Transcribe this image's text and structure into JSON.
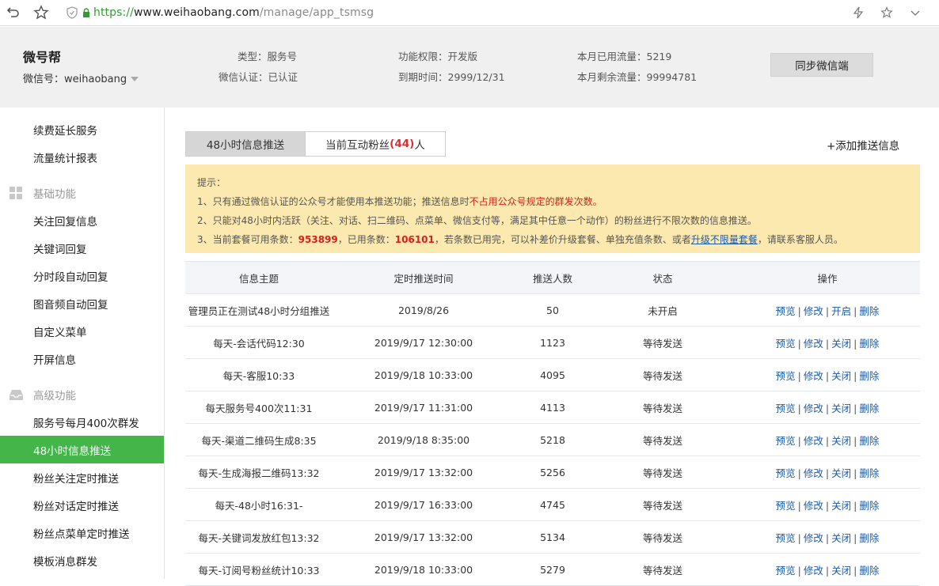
{
  "browser": {
    "url_scheme": "https://",
    "url_host": "www.weihaobang.com",
    "url_path": "/manage/app_tsmsg"
  },
  "account": {
    "name": "微号帮",
    "wechat_id_label": "微信号：weihaobang",
    "type": "类型：服务号",
    "auth": "微信认证：已认证",
    "permission": "功能权限：开发版",
    "expiry": "到期时间：2999/12/31",
    "used_flow": "本月已用流量：5219",
    "remaining_flow": "本月剩余流量：99994781",
    "sync_label": "同步微信端"
  },
  "sidebar": {
    "top_items": [
      "续费延长服务",
      "流量统计报表"
    ],
    "basic_section": "基础功能",
    "basic_items": [
      "关注回复信息",
      "关键词回复",
      "分时段自动回复",
      "图音频自动回复",
      "自定义菜单",
      "开屏信息"
    ],
    "advanced_section": "高级功能",
    "advanced_items": [
      "服务号每月400次群发",
      "48小时信息推送",
      "粉丝关注定时推送",
      "粉丝对话定时推送",
      "粉丝点菜单定时推送",
      "模板消息群发"
    ],
    "active": "48小时信息推送"
  },
  "tabs": {
    "tab1": "48小时信息推送",
    "tab2_prefix": "当前互动粉丝",
    "tab2_count": "(44)",
    "tab2_suffix": "人",
    "add_label": "+添加推送信息"
  },
  "notice": {
    "title": "提示：",
    "line1_a": "1、只有通过微信认证的公众号才能使用本推送功能；推送信息时",
    "line1_red": "不占用公众号规定的群发次数。",
    "line2": "2、只能对48小时内活跃（关注、对话、扫二维码、点菜单、微信支付等，满足其中任意一个动作）的粉丝进行不限次数的信息推送。",
    "line3_a": "3、当前套餐可用条数：",
    "line3_avail": "953899",
    "line3_b": "，已用条数：",
    "line3_used": "106101",
    "line3_c": "，若条数已用完，可以补差价升级套餐、单独充值条数、或者",
    "line3_link": "升级不限量套餐",
    "line3_d": "，请联系客服人员。"
  },
  "table": {
    "headers": [
      "信息主题",
      "定时推送时间",
      "推送人数",
      "状态",
      "操作"
    ],
    "op_preview": "预览",
    "op_edit": "修改",
    "op_open": "开启",
    "op_close": "关闭",
    "op_delete": "删除",
    "rows": [
      {
        "title": "管理员正在测试48小时分组推送",
        "time": "2019/8/26",
        "count": "50",
        "status": "未开启"
      },
      {
        "title": "每天-会话代码12:30",
        "time": "2019/9/17 12:30:00",
        "count": "1123",
        "status": "等待发送"
      },
      {
        "title": "每天-客服10:33",
        "time": "2019/9/18 10:33:00",
        "count": "4095",
        "status": "等待发送"
      },
      {
        "title": "每天服务号400次11:31",
        "time": "2019/9/17 11:31:00",
        "count": "4113",
        "status": "等待发送"
      },
      {
        "title": "每天-渠道二维码生成8:35",
        "time": "2019/9/18 8:35:00",
        "count": "5218",
        "status": "等待发送"
      },
      {
        "title": "每天-生成海报二维码13:32",
        "time": "2019/9/17 13:32:00",
        "count": "5256",
        "status": "等待发送"
      },
      {
        "title": "每天-48小时16:31-",
        "time": "2019/9/17 16:33:00",
        "count": "4745",
        "status": "等待发送"
      },
      {
        "title": "每天-关键词发放红包13:32",
        "time": "2019/9/17 13:32:00",
        "count": "5134",
        "status": "等待发送"
      },
      {
        "title": "每天-订阅号粉丝统计10:33",
        "time": "2019/9/18 10:33:00",
        "count": "5279",
        "status": "等待发送"
      }
    ]
  }
}
